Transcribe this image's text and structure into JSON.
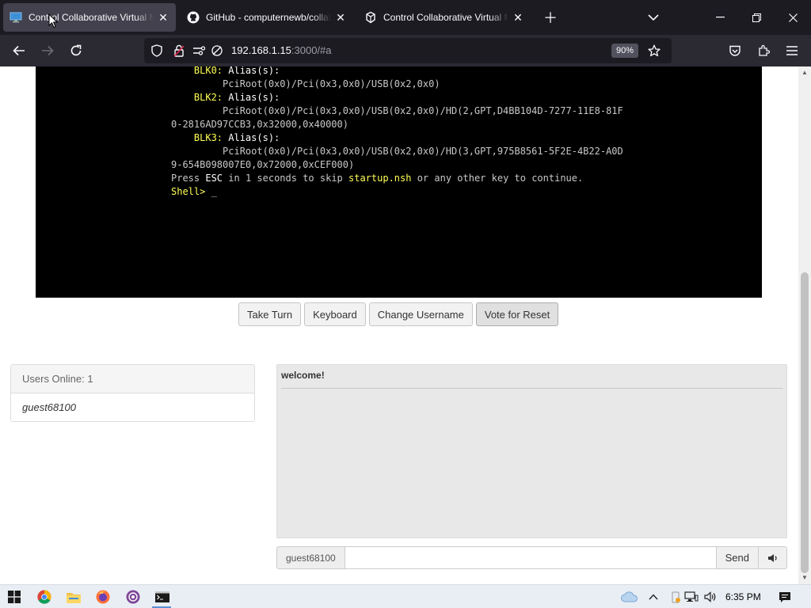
{
  "browser": {
    "tabs": [
      {
        "title": "Control Collaborative Virtual Machine",
        "favicon": "monitor-icon",
        "active": true
      },
      {
        "title": "GitHub - computernewb/collab-vm",
        "favicon": "github-icon",
        "active": false
      },
      {
        "title": "Control Collaborative Virtual Machine",
        "favicon": "vm-icon",
        "active": false
      }
    ],
    "url_host": "192.168.1.15",
    "url_rest": ":3000/#a",
    "zoom": "90%"
  },
  "terminal": {
    "lines": [
      {
        "indent": "    ",
        "label": "BLK0:",
        "text": " Alias(s):"
      },
      {
        "indent": "         ",
        "label": "",
        "text": "PciRoot(0x0)/Pci(0x3,0x0)/USB(0x2,0x0)"
      },
      {
        "indent": "    ",
        "label": "BLK2:",
        "text": " Alias(s):"
      },
      {
        "indent": "         ",
        "label": "",
        "text": "PciRoot(0x0)/Pci(0x3,0x0)/USB(0x2,0x0)/HD(2,GPT,D4BB104D-7277-11E8-81F"
      },
      {
        "indent": "",
        "label": "",
        "text": "0-2816AD97CCB3,0x32000,0x40000)"
      },
      {
        "indent": "    ",
        "label": "BLK3:",
        "text": " Alias(s):"
      },
      {
        "indent": "         ",
        "label": "",
        "text": "PciRoot(0x0)/Pci(0x3,0x0)/USB(0x2,0x0)/HD(3,GPT,975B8561-5F2E-4B22-A0D"
      },
      {
        "indent": "",
        "label": "",
        "text": "9-654B098007E0,0x72000,0xCEF000)"
      }
    ],
    "press_prefix": "Press ",
    "press_key": "ESC",
    "press_mid": " in 1 seconds to skip ",
    "press_file": "startup.nsh",
    "press_suffix": " or any other key to continue.",
    "prompt": "Shell> ",
    "cursor": "_"
  },
  "vm_controls": {
    "take_turn": "Take Turn",
    "keyboard": "Keyboard",
    "change_username": "Change Username",
    "vote_reset": "Vote for Reset"
  },
  "users": {
    "header": "Users Online: 1",
    "list": [
      "guest68100"
    ]
  },
  "chat": {
    "messages": [
      "welcome!"
    ],
    "username": "guest68100",
    "input_value": "",
    "send_label": "Send"
  },
  "taskbar": {
    "time": "6:35 PM"
  },
  "colors": {
    "terminal_yellow": "#ffff55",
    "browser_dark": "#1c1b22"
  }
}
